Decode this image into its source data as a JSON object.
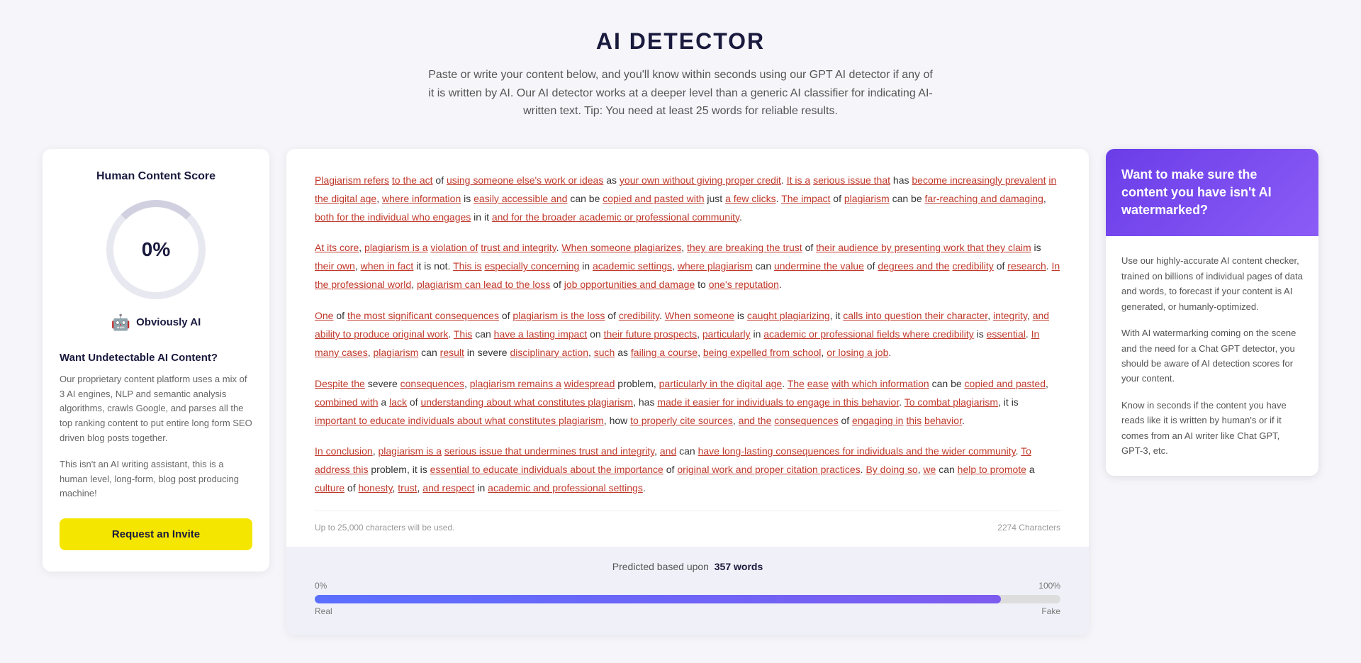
{
  "header": {
    "title": "AI DETECTOR",
    "subtitle": "Paste or write your content below, and you'll know within seconds using our GPT AI detector if any of it is written by AI. Our AI detector works at a deeper level than a generic AI classifier for indicating AI-written text. Tip: You need at least 25 words for reliable results."
  },
  "left_panel": {
    "title": "Human Content Score",
    "score": "0%",
    "ai_label": "Obviously AI",
    "uai_title": "Want Undetectable AI Content?",
    "uai_desc": "Our proprietary content platform uses a mix of 3 AI engines, NLP and semantic analysis algorithms, crawls Google, and parses all the top ranking content to put entire long form SEO driven blog posts together.",
    "uai_note": "This isn't an AI writing assistant, this is a human level, long-form, blog post producing machine!",
    "invite_button": "Request an Invite"
  },
  "center_panel": {
    "paragraphs": [
      "Plagiarism refers to the act of using someone else's work or ideas as your own without giving proper credit. It is a serious issue that has become increasingly prevalent in the digital age, where information is easily accessible and can be copied and pasted with just a few clicks. The impact of plagiarism can be far-reaching and damaging, both for the individual who engages in it and for the broader academic or professional community.",
      "At its core, plagiarism is a violation of trust and integrity. When someone plagiarizes, they are breaking the trust of their audience by presenting work that they claim is their own, when in fact it is not. This is especially concerning in academic settings, where plagiarism can undermine the value of degrees and the credibility of research. In the professional world, plagiarism can lead to the loss of job opportunities and damage to one's reputation.",
      "One of the most significant consequences of plagiarism is the loss of credibility. When someone is caught plagiarizing, it calls into question their character, integrity, and ability to produce original work. This can have a lasting impact on their future prospects, particularly in academic or professional fields where credibility is essential. In many cases, plagiarism can result in severe disciplinary action, such as failing a course, being expelled from school, or losing a job.",
      "Despite the severe consequences, plagiarism remains a widespread problem, particularly in the digital age. The ease with which information can be copied and pasted, combined with a lack of understanding about what constitutes plagiarism, has made it easier for individuals to engage in this behavior. To combat plagiarism, it is important to educate individuals about what constitutes plagiarism, how to properly cite sources, and the consequences of engaging in this behavior.",
      "In conclusion, plagiarism is a serious issue that undermines trust and integrity, and can have long-lasting consequences for individuals and the wider community. To address this problem, it is essential to educate individuals about the importance of original work and proper citation practices. By doing so, we can help to promote a culture of honesty, trust, and respect in academic and professional settings."
    ],
    "footer_left": "Up to 25,000 characters will be used.",
    "footer_right": "2274 Characters",
    "prediction_label": "Predicted based upon",
    "prediction_words": "357 words",
    "bar_left_label": "0%",
    "bar_right_label": "100%",
    "bar_left_sublabel": "Real",
    "bar_right_sublabel": "Fake"
  },
  "right_panel": {
    "header_title": "Want to make sure the content you have isn't AI watermarked?",
    "body_p1": "Use our highly-accurate AI content checker, trained on billions of individual pages of data and words, to forecast if your content is AI generated, or humanly-optimized.",
    "body_p2": "With AI watermarking coming on the scene and the need for a Chat GPT detector, you should be aware of AI detection scores for your content.",
    "body_p3": "Know in seconds if the content you have reads like it is written by human's or if it comes from an AI writer like Chat GPT, GPT-3, etc."
  },
  "icons": {
    "robot": "🤖"
  }
}
